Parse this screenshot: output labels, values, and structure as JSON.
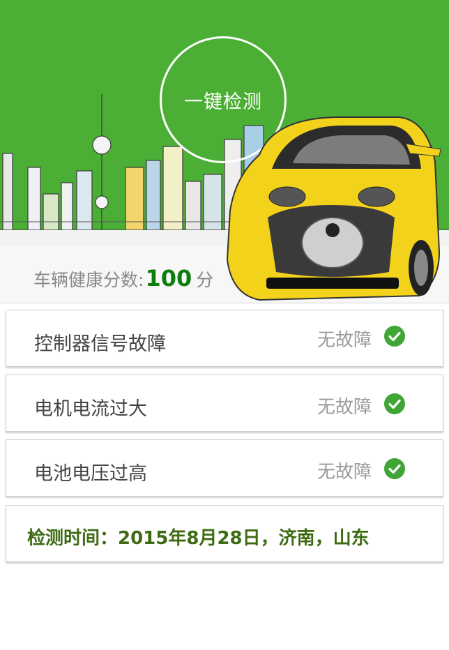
{
  "hero": {
    "scan_button_label": "一键检测",
    "bg_color": "#4caf35"
  },
  "score": {
    "label": "车辆健康分数:",
    "value": "100",
    "unit": "分",
    "value_color": "#0d7e0d"
  },
  "checks": [
    {
      "title": "控制器信号故障",
      "status": "无故障"
    },
    {
      "title": "电机电流过大",
      "status": "无故障"
    },
    {
      "title": "电池电压过高",
      "status": "无故障"
    }
  ],
  "footer": {
    "text": "检测时间：2015年8月28日，济南，山东"
  }
}
